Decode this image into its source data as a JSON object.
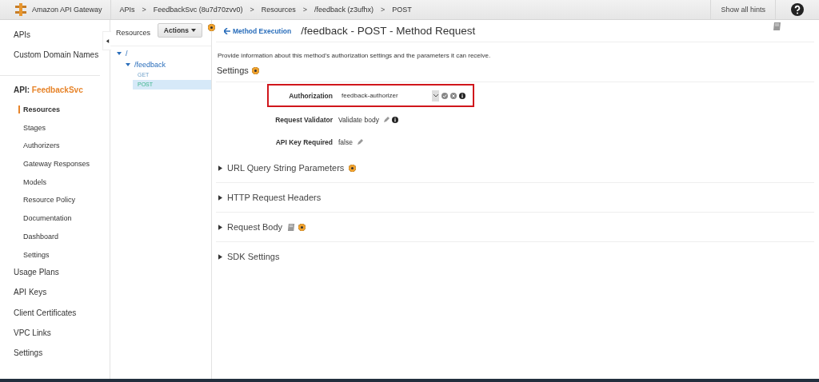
{
  "header": {
    "brand": "Amazon API Gateway",
    "breadcrumbs": [
      "APIs",
      "FeedbackSvc (8u7d70zvv0)",
      "Resources",
      "/feedback (z3ufhx)",
      "POST"
    ],
    "separator": ">",
    "hints_button": "Show all hints"
  },
  "sidebar": {
    "top_items": [
      "APIs",
      "Custom Domain Names"
    ],
    "api_label": "API:",
    "api_name": "FeedbackSvc",
    "sub_items": [
      {
        "label": "Resources",
        "selected": true
      },
      {
        "label": "Stages",
        "selected": false
      },
      {
        "label": "Authorizers",
        "selected": false
      },
      {
        "label": "Gateway Responses",
        "selected": false
      },
      {
        "label": "Models",
        "selected": false
      },
      {
        "label": "Resource Policy",
        "selected": false
      },
      {
        "label": "Documentation",
        "selected": false
      },
      {
        "label": "Dashboard",
        "selected": false
      },
      {
        "label": "Settings",
        "selected": false
      }
    ],
    "bottom_items": [
      "Usage Plans",
      "API Keys",
      "Client Certificates",
      "VPC Links",
      "Settings"
    ]
  },
  "resources": {
    "title": "Resources",
    "actions": "Actions",
    "tree": [
      {
        "label": "/",
        "expanded": true,
        "selected": false,
        "children": [
          {
            "label": "/feedback",
            "expanded": true,
            "selected": false,
            "children": [
              {
                "label": "GET",
                "selected": false
              },
              {
                "label": "POST",
                "selected": true
              }
            ]
          }
        ]
      }
    ]
  },
  "content": {
    "back_link": "Method Execution",
    "title": "/feedback - POST - Method Request",
    "description": "Provide information about this method's authorization settings and the parameters it can receive.",
    "settings_heading": "Settings",
    "fields": [
      {
        "kind": "select",
        "label": "Authorization",
        "value": "feedback-authorizer",
        "highlighted": true
      },
      {
        "kind": "editable",
        "label": "Request Validator",
        "value": "Validate body",
        "info": true,
        "highlighted": false
      },
      {
        "kind": "editable",
        "label": "API Key Required",
        "value": "false",
        "info": false,
        "highlighted": false
      }
    ],
    "sections": [
      {
        "title": "URL Query String Parameters",
        "expanded": false,
        "hint": true,
        "doc": false
      },
      {
        "title": "HTTP Request Headers",
        "expanded": false,
        "hint": false,
        "doc": false
      },
      {
        "title": "Request Body",
        "expanded": false,
        "hint": true,
        "doc": true
      },
      {
        "title": "SDK Settings",
        "expanded": false,
        "hint": false,
        "doc": false
      }
    ]
  }
}
